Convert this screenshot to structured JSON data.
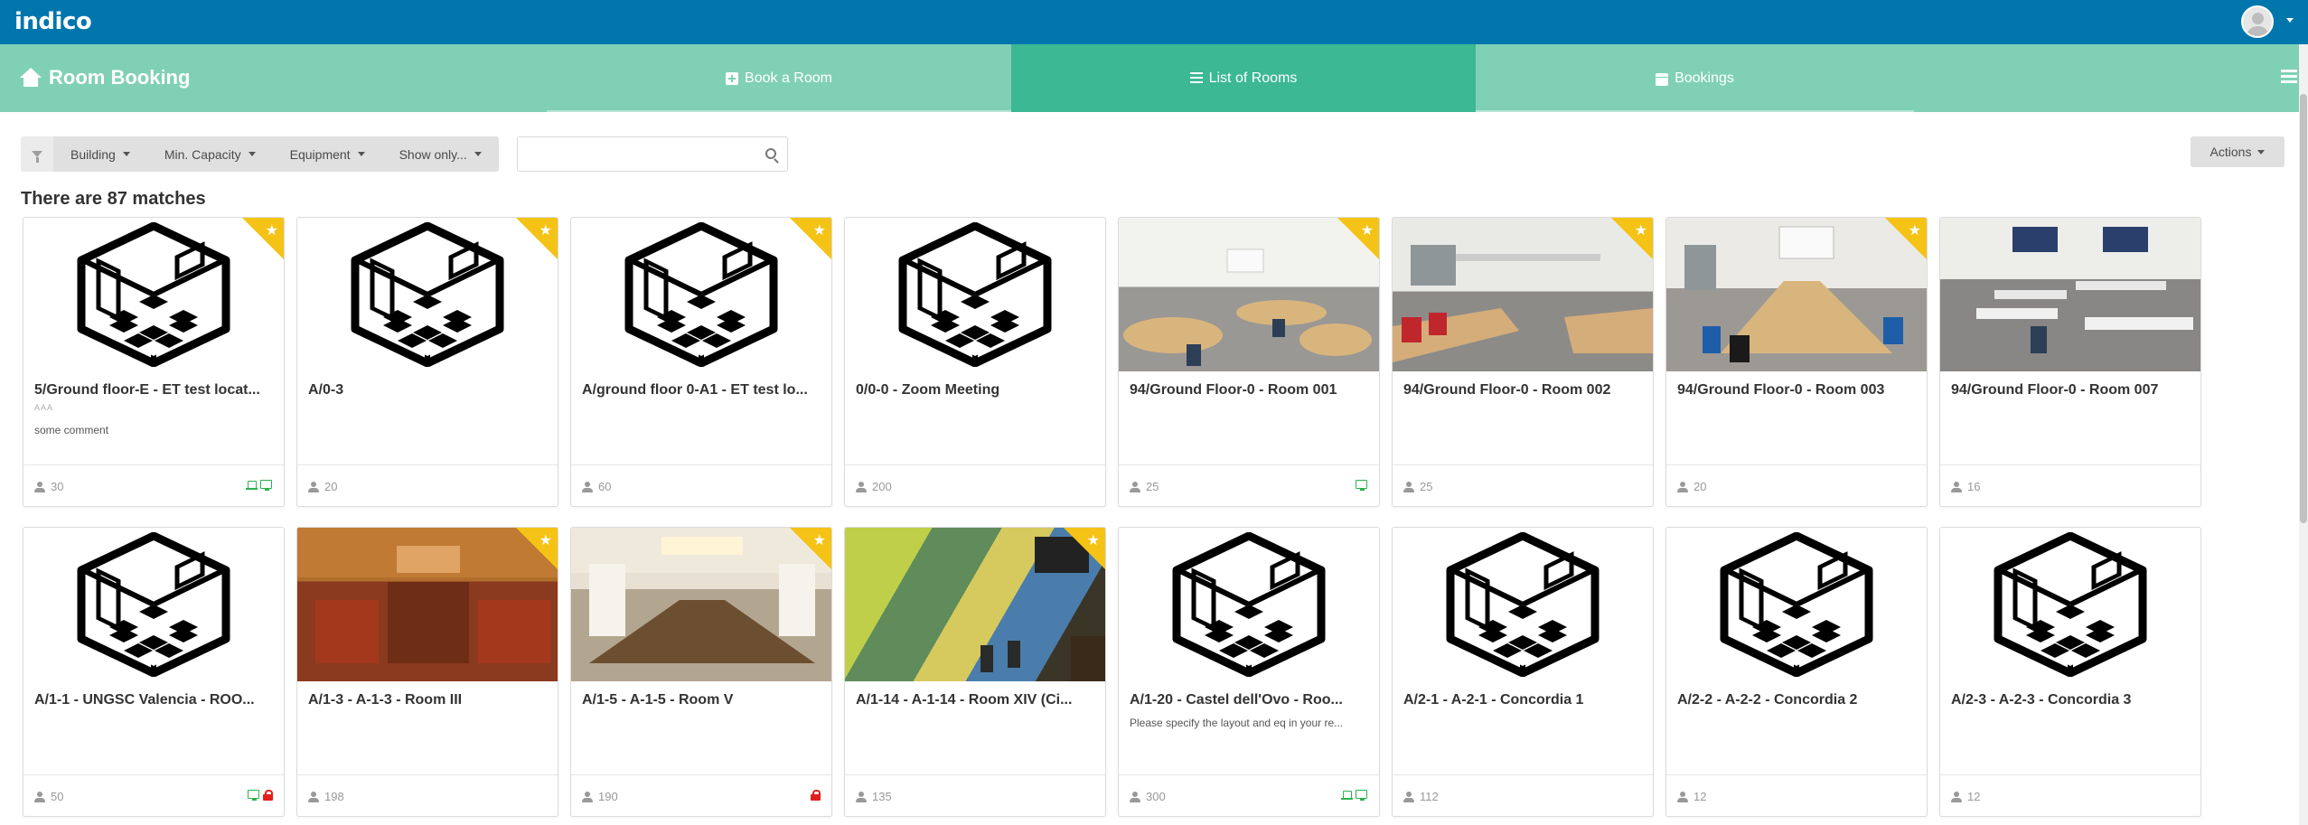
{
  "topbar": {
    "logo": "indico"
  },
  "nav": {
    "brand": "Room Booking",
    "tabs": [
      {
        "label": "Book a Room",
        "icon": "plus-square-icon"
      },
      {
        "label": "List of Rooms",
        "icon": "list-icon",
        "active": true
      },
      {
        "label": "Bookings",
        "icon": "calendar-icon"
      }
    ]
  },
  "filters": {
    "items": [
      {
        "label": "Building"
      },
      {
        "label": "Min. Capacity"
      },
      {
        "label": "Equipment"
      },
      {
        "label": "Show only..."
      }
    ]
  },
  "search": {
    "value": "",
    "placeholder": ""
  },
  "actions_label": "Actions",
  "matches_text": "There are 87 matches",
  "colors": {
    "topbar": "#0176ad",
    "navbar": "#80d0b5",
    "active_tab": "#3cb893",
    "favorite": "#f4c315",
    "equipment": "#2bb24c",
    "lock": "#e0201b"
  },
  "rooms": [
    {
      "title": "5/Ground floor-E - ET test locat...",
      "subtitle": "AAA",
      "comment": "some comment",
      "capacity": "30",
      "favorite": true,
      "image": "placeholder",
      "equipment": [
        "laptop",
        "screen"
      ]
    },
    {
      "title": "A/0-3",
      "capacity": "20",
      "favorite": true,
      "image": "placeholder",
      "equipment": []
    },
    {
      "title": "A/ground floor 0-A1 - ET test lo...",
      "capacity": "60",
      "favorite": true,
      "image": "placeholder",
      "equipment": []
    },
    {
      "title": "0/0-0 - Zoom Meeting",
      "capacity": "200",
      "favorite": false,
      "image": "placeholder",
      "equipment": []
    },
    {
      "title": "94/Ground Floor-0 - Room 001",
      "capacity": "25",
      "favorite": true,
      "image": "photo-round-tables",
      "equipment": [
        "screen"
      ]
    },
    {
      "title": "94/Ground Floor-0 - Room 002",
      "capacity": "25",
      "favorite": true,
      "image": "photo-red-chairs",
      "equipment": []
    },
    {
      "title": "94/Ground Floor-0 - Room 003",
      "capacity": "20",
      "favorite": true,
      "image": "photo-blue-chairs",
      "equipment": []
    },
    {
      "title": "94/Ground Floor-0 - Room 007",
      "capacity": "16",
      "favorite": false,
      "image": "photo-classroom",
      "equipment": []
    },
    {
      "title": "A/1-1 - UNGSC Valencia - ROO...",
      "capacity": "50",
      "favorite": false,
      "image": "placeholder",
      "equipment": [
        "screen",
        "lock"
      ]
    },
    {
      "title": "A/1-3 - A-1-3 - Room III",
      "capacity": "198",
      "favorite": true,
      "image": "photo-assembly-red",
      "equipment": []
    },
    {
      "title": "A/1-5 - A-1-5 - Room V",
      "capacity": "190",
      "favorite": true,
      "image": "photo-assembly-white",
      "equipment": [
        "lock"
      ]
    },
    {
      "title": "A/1-14 - A-1-14 - Room XIV (Ci...",
      "capacity": "135",
      "favorite": true,
      "image": "photo-mural",
      "equipment": []
    },
    {
      "title": "A/1-20 - Castel dell'Ovo - Roo...",
      "comment": "Please specify the layout and eq in your re...",
      "capacity": "300",
      "favorite": false,
      "image": "placeholder",
      "equipment": [
        "laptop",
        "screen"
      ]
    },
    {
      "title": "A/2-1 - A-2-1 - Concordia 1",
      "capacity": "112",
      "favorite": false,
      "image": "placeholder",
      "equipment": []
    },
    {
      "title": "A/2-2 - A-2-2 - Concordia 2",
      "capacity": "12",
      "favorite": false,
      "image": "placeholder",
      "equipment": []
    },
    {
      "title": "A/2-3 - A-2-3 - Concordia 3",
      "capacity": "12",
      "favorite": false,
      "image": "placeholder",
      "equipment": []
    }
  ]
}
